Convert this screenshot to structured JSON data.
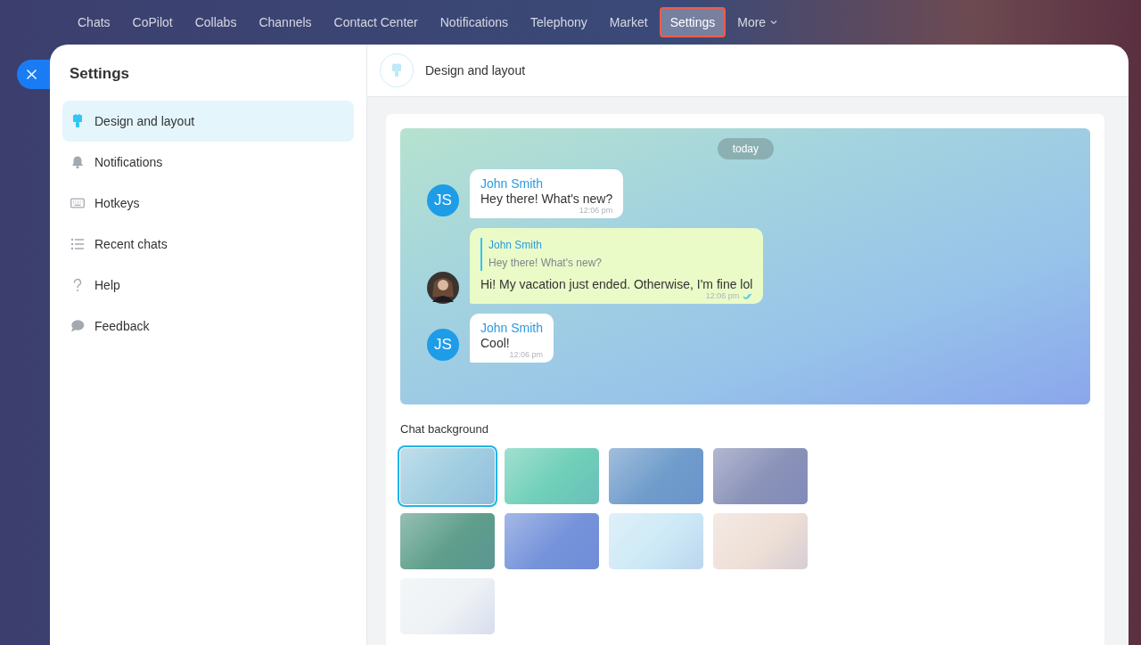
{
  "nav": {
    "items": [
      {
        "label": "Chats",
        "selected": false,
        "kind": "link"
      },
      {
        "label": "CoPilot",
        "selected": false,
        "kind": "link"
      },
      {
        "label": "Collabs",
        "selected": false,
        "kind": "link"
      },
      {
        "label": "Channels",
        "selected": false,
        "kind": "link"
      },
      {
        "label": "Contact Center",
        "selected": false,
        "kind": "link"
      },
      {
        "label": "Notifications",
        "selected": false,
        "kind": "link"
      },
      {
        "label": "Telephony",
        "selected": false,
        "kind": "link"
      },
      {
        "label": "Market",
        "selected": false,
        "kind": "link"
      },
      {
        "label": "Settings",
        "selected": true,
        "kind": "link"
      },
      {
        "label": "More",
        "selected": false,
        "kind": "dropdown"
      }
    ]
  },
  "sidebar": {
    "title": "Settings",
    "items": [
      {
        "label": "Design and layout",
        "selected": true,
        "kind": "brush"
      },
      {
        "label": "Notifications",
        "selected": false,
        "kind": "bell"
      },
      {
        "label": "Hotkeys",
        "selected": false,
        "kind": "keyboard"
      },
      {
        "label": "Recent chats",
        "selected": false,
        "kind": "list"
      },
      {
        "label": "Help",
        "selected": false,
        "kind": "help"
      },
      {
        "label": "Feedback",
        "selected": false,
        "kind": "speech"
      }
    ]
  },
  "header": {
    "title": "Design and layout"
  },
  "preview": {
    "date": "today",
    "messages": [
      {
        "kind": "incoming",
        "avatar": "JS",
        "author": "John Smith",
        "text": "Hey there! What's new?",
        "time": "12:06 pm"
      },
      {
        "kind": "outgoing",
        "reply": {
          "author": "John Smith",
          "text": "Hey there! What's new?"
        },
        "text": "Hi! My vacation just ended. Otherwise, I'm fine lol",
        "time": "12:06 pm",
        "read": true
      },
      {
        "kind": "incoming",
        "avatar": "JS",
        "author": "John Smith",
        "text": "Cool!",
        "time": "12:06 pm"
      }
    ]
  },
  "backgrounds": {
    "title": "Chat background",
    "swatches": [
      {
        "color": "#9fcde0",
        "selected": true
      },
      {
        "color": "#6fcfb8",
        "selected": false
      },
      {
        "color": "#6f9ccb",
        "selected": false
      },
      {
        "color": "#8a92b8",
        "selected": false
      },
      {
        "color": "#5e9e8a",
        "selected": false
      },
      {
        "color": "#7593da",
        "selected": false
      },
      {
        "color": "#cde9f6",
        "selected": false
      },
      {
        "color": "#eedfd6",
        "selected": false
      },
      {
        "color": "#eef2f5",
        "selected": false
      }
    ]
  }
}
